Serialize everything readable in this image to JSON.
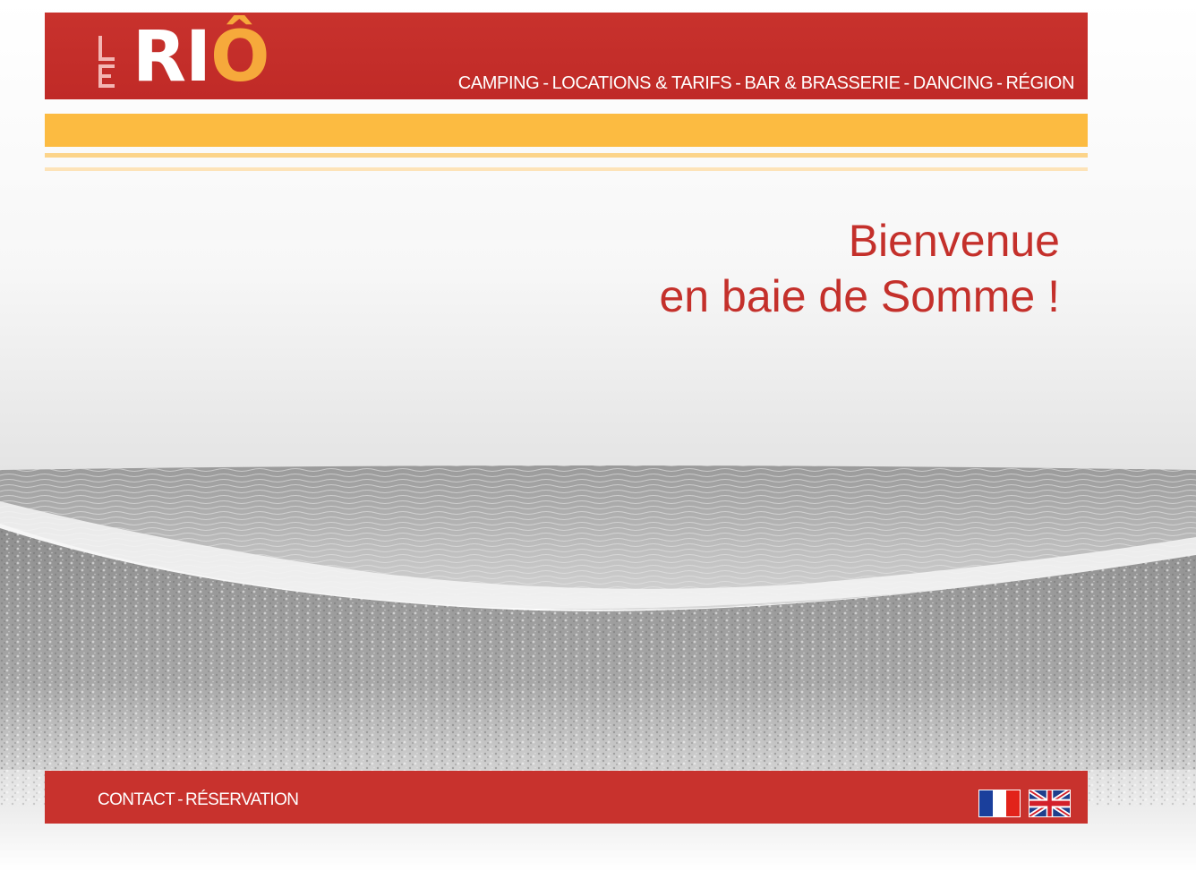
{
  "brand": {
    "logo_small": "LE",
    "logo_main": "RI",
    "logo_accent": "Ô",
    "colors": {
      "primary_red": "#c8322d",
      "accent_orange": "#fcbb41",
      "text_red": "#c4302b"
    }
  },
  "nav": {
    "items": [
      {
        "label": "CAMPING"
      },
      {
        "label": "LOCATIONS & TARIFS"
      },
      {
        "label": "BAR & BRASSERIE"
      },
      {
        "label": "DANCING"
      },
      {
        "label": "RÉGION"
      }
    ],
    "separator": "-"
  },
  "welcome": {
    "line1": "Bienvenue",
    "line2": "en baie de Somme !"
  },
  "footer": {
    "contact_label": "CONTACT",
    "separator": "-",
    "reservation_label": "RÉSERVATION"
  },
  "languages": [
    {
      "code": "fr",
      "icon": "flag-france-icon"
    },
    {
      "code": "en",
      "icon": "flag-uk-icon"
    }
  ]
}
